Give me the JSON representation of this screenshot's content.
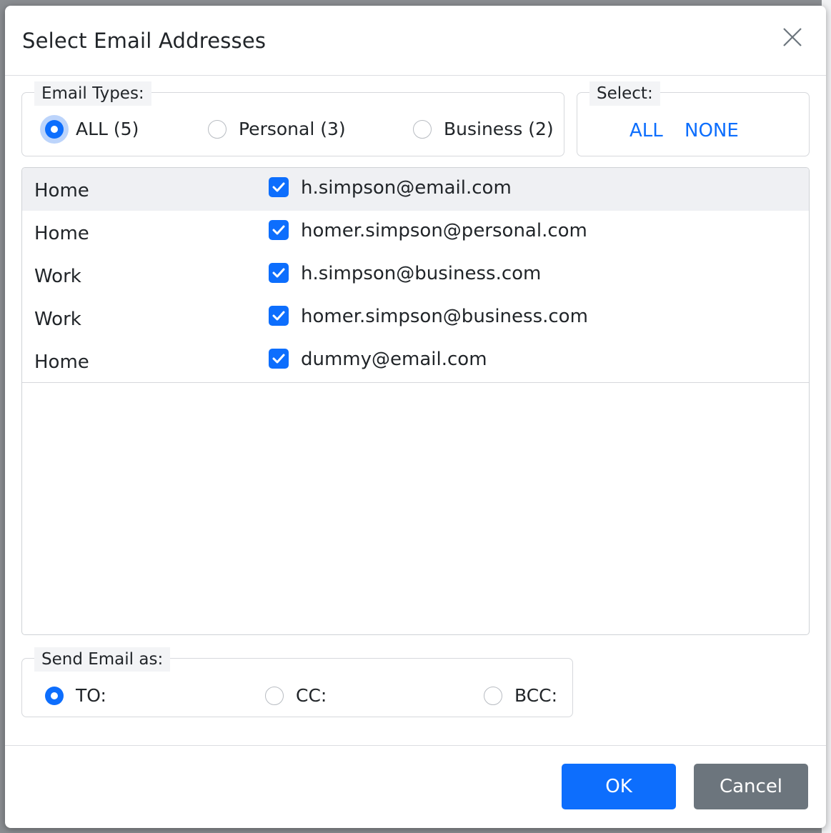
{
  "dialog": {
    "title": "Select Email Addresses"
  },
  "email_types": {
    "legend": "Email Types:",
    "options": [
      {
        "label": "ALL (5)",
        "checked": true
      },
      {
        "label": "Personal (3)",
        "checked": false
      },
      {
        "label": "Business (2)",
        "checked": false
      }
    ]
  },
  "select": {
    "legend": "Select:",
    "all_label": "ALL",
    "none_label": "NONE"
  },
  "emails": [
    {
      "type": "Home",
      "address": "h.simpson@email.com",
      "checked": true
    },
    {
      "type": "Home",
      "address": "homer.simpson@personal.com",
      "checked": true
    },
    {
      "type": "Work",
      "address": "h.simpson@business.com",
      "checked": true
    },
    {
      "type": "Work",
      "address": "homer.simpson@business.com",
      "checked": true
    },
    {
      "type": "Home",
      "address": "dummy@email.com",
      "checked": true
    }
  ],
  "send_as": {
    "legend": "Send Email as:",
    "options": [
      {
        "label": "TO:",
        "checked": true
      },
      {
        "label": "CC:",
        "checked": false
      },
      {
        "label": "BCC:",
        "checked": false
      }
    ]
  },
  "footer": {
    "ok_label": "OK",
    "cancel_label": "Cancel"
  },
  "colors": {
    "accent": "#0d6efd",
    "secondary": "#6c757d"
  },
  "icons": {
    "close": "close-icon",
    "checkbox": "checkmark-icon"
  }
}
